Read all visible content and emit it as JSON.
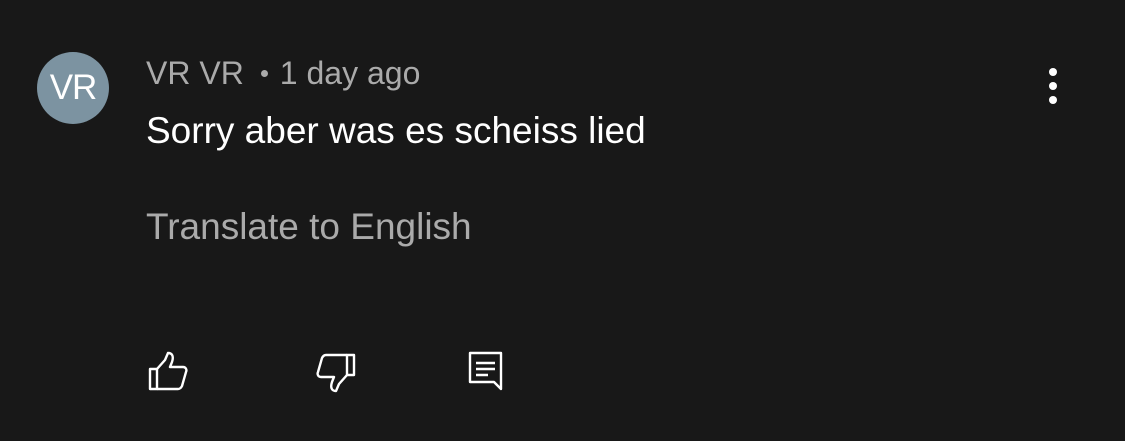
{
  "comment": {
    "avatar_initials": "VR",
    "avatar_color": "#7c93a1",
    "author": "VR VR",
    "timestamp": "1 day ago",
    "text": "Sorry aber was es scheiss lied",
    "translate_label": "Translate to English"
  },
  "actions": {
    "like_icon": "thumbs-up-icon",
    "dislike_icon": "thumbs-down-icon",
    "reply_icon": "reply-comment-icon",
    "menu_icon": "more-vertical-icon"
  },
  "colors": {
    "background": "#181818",
    "primary_text": "#ffffff",
    "secondary_text": "#aaaaaa"
  }
}
